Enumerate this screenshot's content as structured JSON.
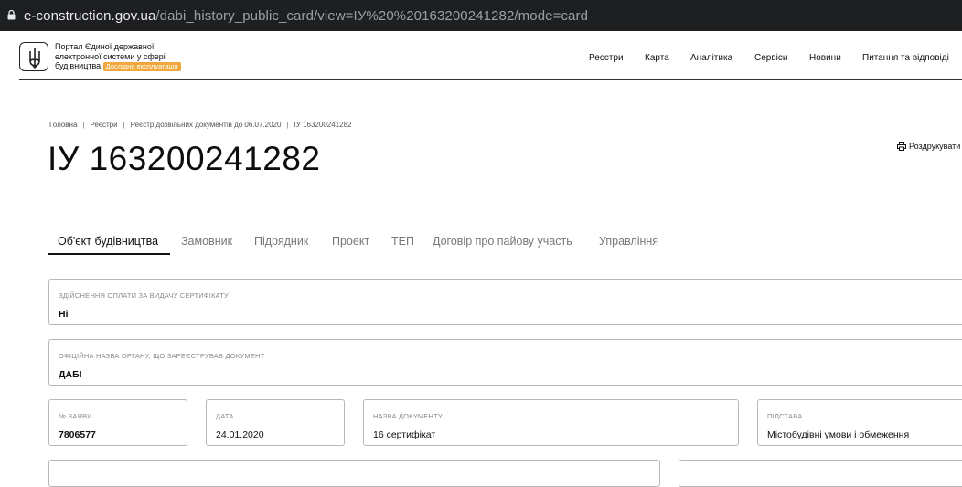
{
  "browser": {
    "url_domain": "e-construction.gov.ua",
    "url_path": "/dabi_history_public_card/view=ІУ%20%20163200241282/mode=card"
  },
  "header": {
    "portal_line1": "Портал Єдиної державної",
    "portal_line2": "електронної системи у сфері",
    "portal_line3": "будівництва",
    "badge": "Дослідна експлуатація",
    "nav": [
      "Реєстри",
      "Карта",
      "Аналітика",
      "Сервіси",
      "Новини",
      "Питання та відповіді"
    ]
  },
  "breadcrumb": [
    "Головна",
    "Реєстри",
    "Реєстр дозвільних документів до 06.07.2020",
    "ІУ 163200241282"
  ],
  "page_title": "ІУ 163200241282",
  "print_label": "Роздрукувати",
  "tabs": [
    "Об'єкт будівництва",
    "Замовник",
    "Підрядник",
    "Проект",
    "ТЕП",
    "Договір про пайову участь",
    "Управління"
  ],
  "fields": {
    "payment": {
      "label": "Здійснення оплати за видачу сертифікату",
      "value": "Ні"
    },
    "authority": {
      "label": "Офіційна назва органу, що зареєстрував документ",
      "value": "ДАБІ"
    },
    "application_no": {
      "label": "№ заяви",
      "value": "7806577"
    },
    "date": {
      "label": "Дата",
      "value": "24.01.2020"
    },
    "doc_name": {
      "label": "Назва документу",
      "value": "16 сертифікат"
    },
    "basis": {
      "label": "Підстава",
      "value": "Містобудівні умови і обмеження"
    }
  }
}
